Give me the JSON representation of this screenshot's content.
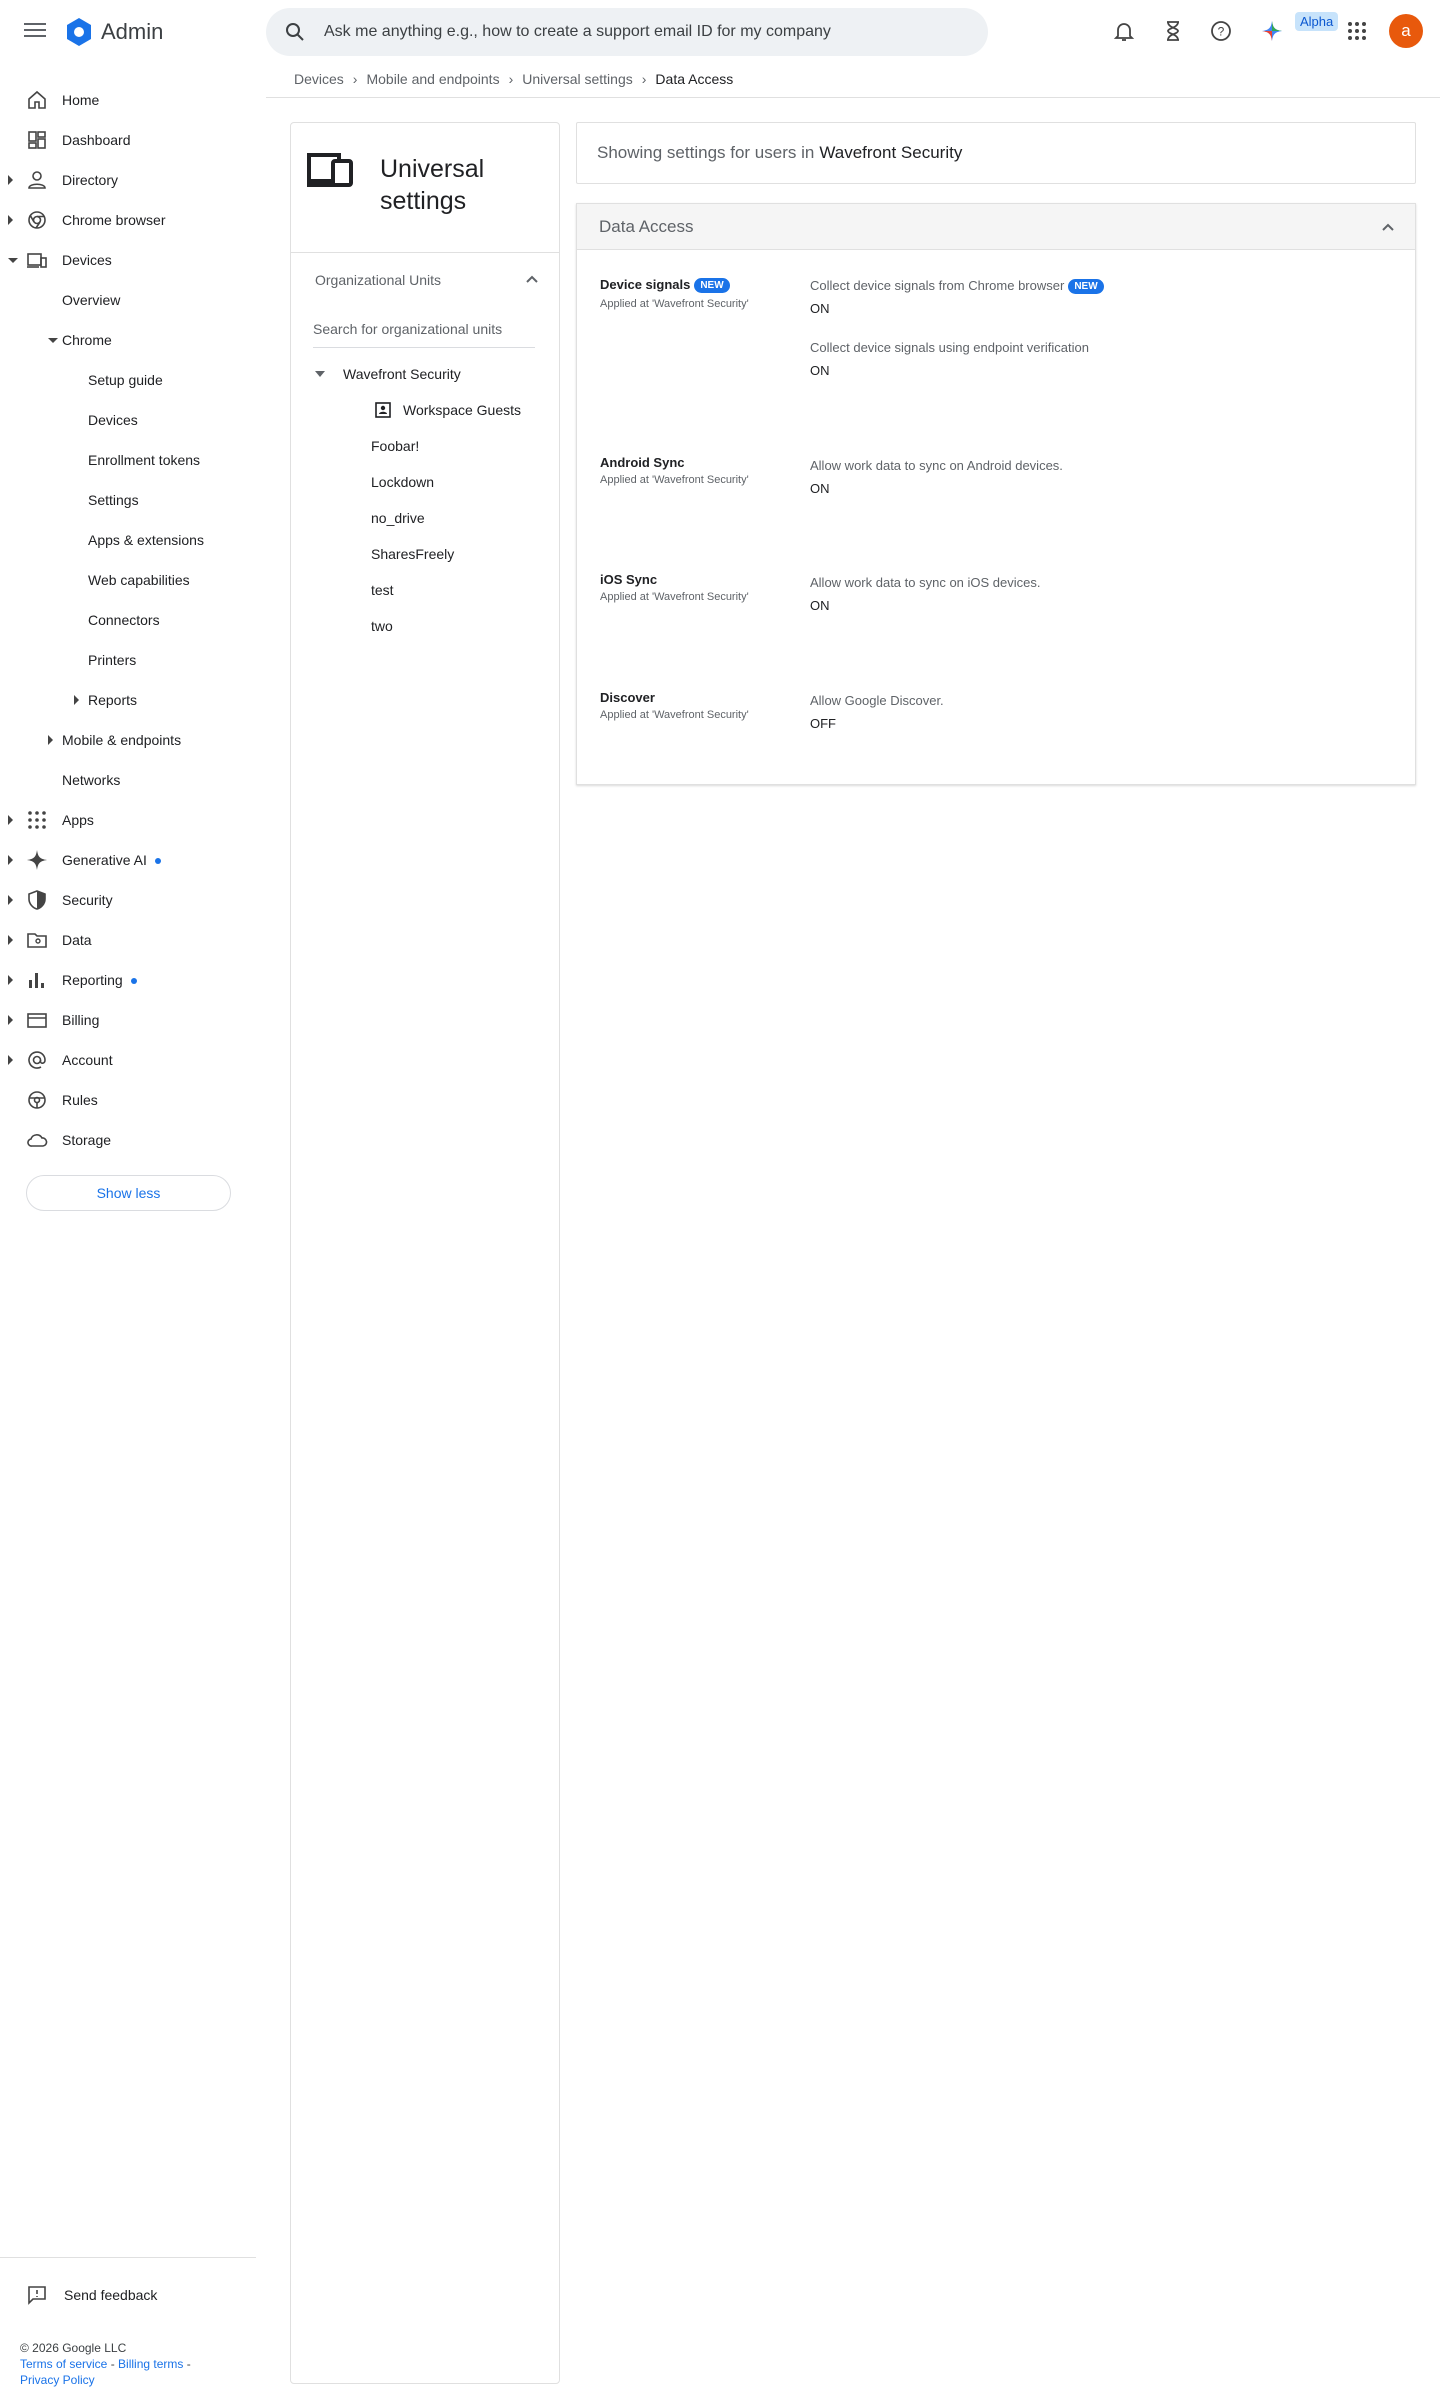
{
  "header": {
    "app_name": "Admin",
    "search_placeholder": "Ask me anything e.g., how to create a support email ID for my company",
    "alpha_badge": "Alpha",
    "avatar_letter": "a"
  },
  "breadcrumb": [
    "Devices",
    "Mobile and endpoints",
    "Universal settings",
    "Data Access"
  ],
  "sidebar": {
    "items": [
      {
        "label": "Home",
        "icon": "home-icon"
      },
      {
        "label": "Dashboard",
        "icon": "dashboard-icon"
      },
      {
        "label": "Directory",
        "icon": "person-icon"
      },
      {
        "label": "Chrome browser",
        "icon": "chrome-icon"
      },
      {
        "label": "Devices",
        "icon": "devices-icon"
      },
      {
        "label": "Overview"
      },
      {
        "label": "Chrome"
      },
      {
        "label": "Setup guide"
      },
      {
        "label": "Devices"
      },
      {
        "label": "Enrollment tokens"
      },
      {
        "label": "Settings"
      },
      {
        "label": "Apps & extensions"
      },
      {
        "label": "Web capabilities"
      },
      {
        "label": "Connectors"
      },
      {
        "label": "Printers"
      },
      {
        "label": "Reports"
      },
      {
        "label": "Mobile & endpoints"
      },
      {
        "label": "Networks"
      },
      {
        "label": "Apps",
        "icon": "apps-grid-icon"
      },
      {
        "label": "Generative AI",
        "icon": "sparkle-icon"
      },
      {
        "label": "Security",
        "icon": "shield-icon"
      },
      {
        "label": "Data",
        "icon": "folder-icon"
      },
      {
        "label": "Reporting",
        "icon": "bar-chart-icon"
      },
      {
        "label": "Billing",
        "icon": "credit-card-icon"
      },
      {
        "label": "Account",
        "icon": "at-icon"
      },
      {
        "label": "Rules",
        "icon": "steering-icon"
      },
      {
        "label": "Storage",
        "icon": "cloud-icon"
      }
    ],
    "show_less": "Show less",
    "send_feedback": "Send feedback",
    "footer": {
      "copyright": "© 2026 Google LLC",
      "terms": "Terms of service",
      "billing_terms": "Billing terms",
      "privacy": "Privacy Policy",
      "separator": " - "
    }
  },
  "ou_panel": {
    "title": "Universal settings",
    "section": "Organizational Units",
    "search_placeholder": "Search for organizational units",
    "root": "Wavefront Security",
    "children": [
      "Workspace Guests",
      "Foobar!",
      "Lockdown",
      "no_drive",
      "SharesFreely",
      "test",
      "two"
    ]
  },
  "content": {
    "showing_prefix": "Showing settings for users in",
    "showing_ou": "Wavefront Security",
    "card_title": "Data Access",
    "new_badge": "NEW",
    "settings": [
      {
        "name": "Device signals",
        "applied": "Applied at 'Wavefront Security'",
        "options": [
          {
            "desc": "Collect device signals from Chrome browser",
            "value": "ON"
          },
          {
            "desc": "Collect device signals using endpoint verification",
            "value": "ON"
          }
        ]
      },
      {
        "name": "Android Sync",
        "applied": "Applied at 'Wavefront Security'",
        "options": [
          {
            "desc": "Allow work data to sync on Android devices.",
            "value": "ON"
          }
        ]
      },
      {
        "name": "iOS Sync",
        "applied": "Applied at 'Wavefront Security'",
        "options": [
          {
            "desc": "Allow work data to sync on iOS devices.",
            "value": "ON"
          }
        ]
      },
      {
        "name": "Discover",
        "applied": "Applied at 'Wavefront Security'",
        "options": [
          {
            "desc": "Allow Google Discover.",
            "value": "OFF"
          }
        ]
      }
    ]
  },
  "colors": {
    "accent": "#1a73e8",
    "avatar": "#e8590c",
    "search_bg": "#eef1f4"
  }
}
